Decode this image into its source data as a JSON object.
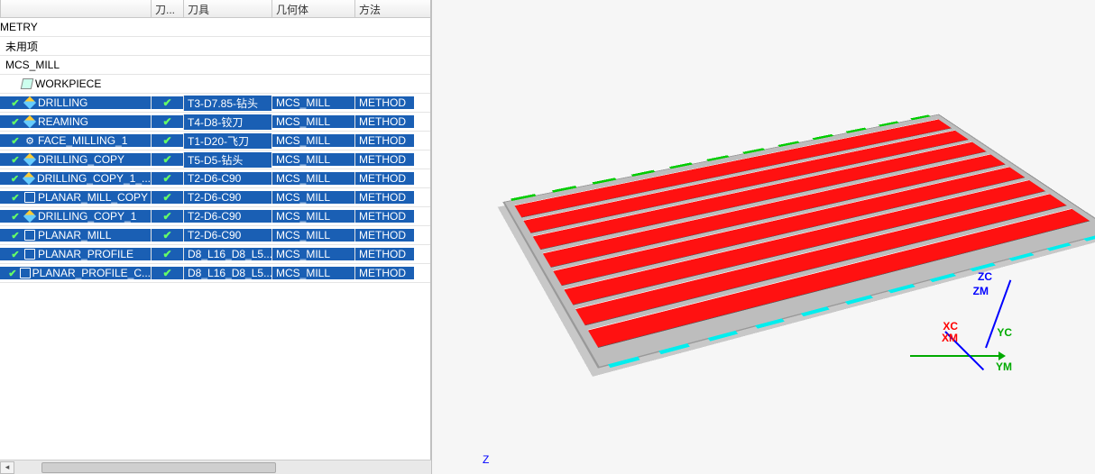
{
  "headers": {
    "c0": "",
    "c1": "刀...",
    "c2": "刀具",
    "c3": "几何体",
    "c4": "方法"
  },
  "tree": [
    {
      "indent": 0,
      "icon": "",
      "label": "METRY",
      "selected": false
    },
    {
      "indent": 6,
      "icon": "",
      "label": "未用项",
      "selected": false
    },
    {
      "indent": 6,
      "icon": "",
      "label": "MCS_MILL",
      "selected": false
    },
    {
      "indent": 24,
      "icon": "cube",
      "label": "WORKPIECE",
      "selected": false
    },
    {
      "indent": 10,
      "icon": "edit",
      "label": "DRILLING",
      "check": true,
      "tool": "T3-D7.85-钻头",
      "geom": "MCS_MILL",
      "method": "METHOD",
      "selected": true
    },
    {
      "indent": 10,
      "icon": "edit",
      "label": "REAMING",
      "check": true,
      "tool": "T4-D8-铰刀",
      "geom": "MCS_MILL",
      "method": "METHOD",
      "selected": true
    },
    {
      "indent": 10,
      "icon": "gear",
      "label": "FACE_MILLING_1",
      "check": true,
      "tool": "T1-D20-飞刀",
      "geom": "MCS_MILL",
      "method": "METHOD",
      "selected": true
    },
    {
      "indent": 10,
      "icon": "edit",
      "label": "DRILLING_COPY",
      "check": true,
      "tool": "T5-D5-钻头",
      "geom": "MCS_MILL",
      "method": "METHOD",
      "selected": true
    },
    {
      "indent": 10,
      "icon": "edit",
      "label": "DRILLING_COPY_1_...",
      "check": true,
      "tool": "T2-D6-C90",
      "geom": "MCS_MILL",
      "method": "METHOD",
      "selected": true
    },
    {
      "indent": 10,
      "icon": "path",
      "label": "PLANAR_MILL_COPY",
      "check": true,
      "tool": "T2-D6-C90",
      "geom": "MCS_MILL",
      "method": "METHOD",
      "selected": true
    },
    {
      "indent": 10,
      "icon": "edit",
      "label": "DRILLING_COPY_1",
      "check": true,
      "tool": "T2-D6-C90",
      "geom": "MCS_MILL",
      "method": "METHOD",
      "selected": true
    },
    {
      "indent": 10,
      "icon": "path",
      "label": "PLANAR_MILL",
      "check": true,
      "tool": "T2-D6-C90",
      "geom": "MCS_MILL",
      "method": "METHOD",
      "selected": true
    },
    {
      "indent": 10,
      "icon": "path",
      "label": "PLANAR_PROFILE",
      "check": true,
      "tool": "D8_L16_D8_L5...",
      "geom": "MCS_MILL",
      "method": "METHOD",
      "selected": true
    },
    {
      "indent": 10,
      "icon": "path",
      "label": "PLANAR_PROFILE_C...",
      "check": true,
      "tool": "D8_L16_D8_L5...",
      "geom": "MCS_MILL",
      "method": "METHOD",
      "selected": true
    }
  ],
  "axes": {
    "xc": "XC",
    "xm": "XM",
    "yc": "YC",
    "ym": "YM",
    "zc": "ZC",
    "zm": "ZM",
    "z": "Z"
  }
}
